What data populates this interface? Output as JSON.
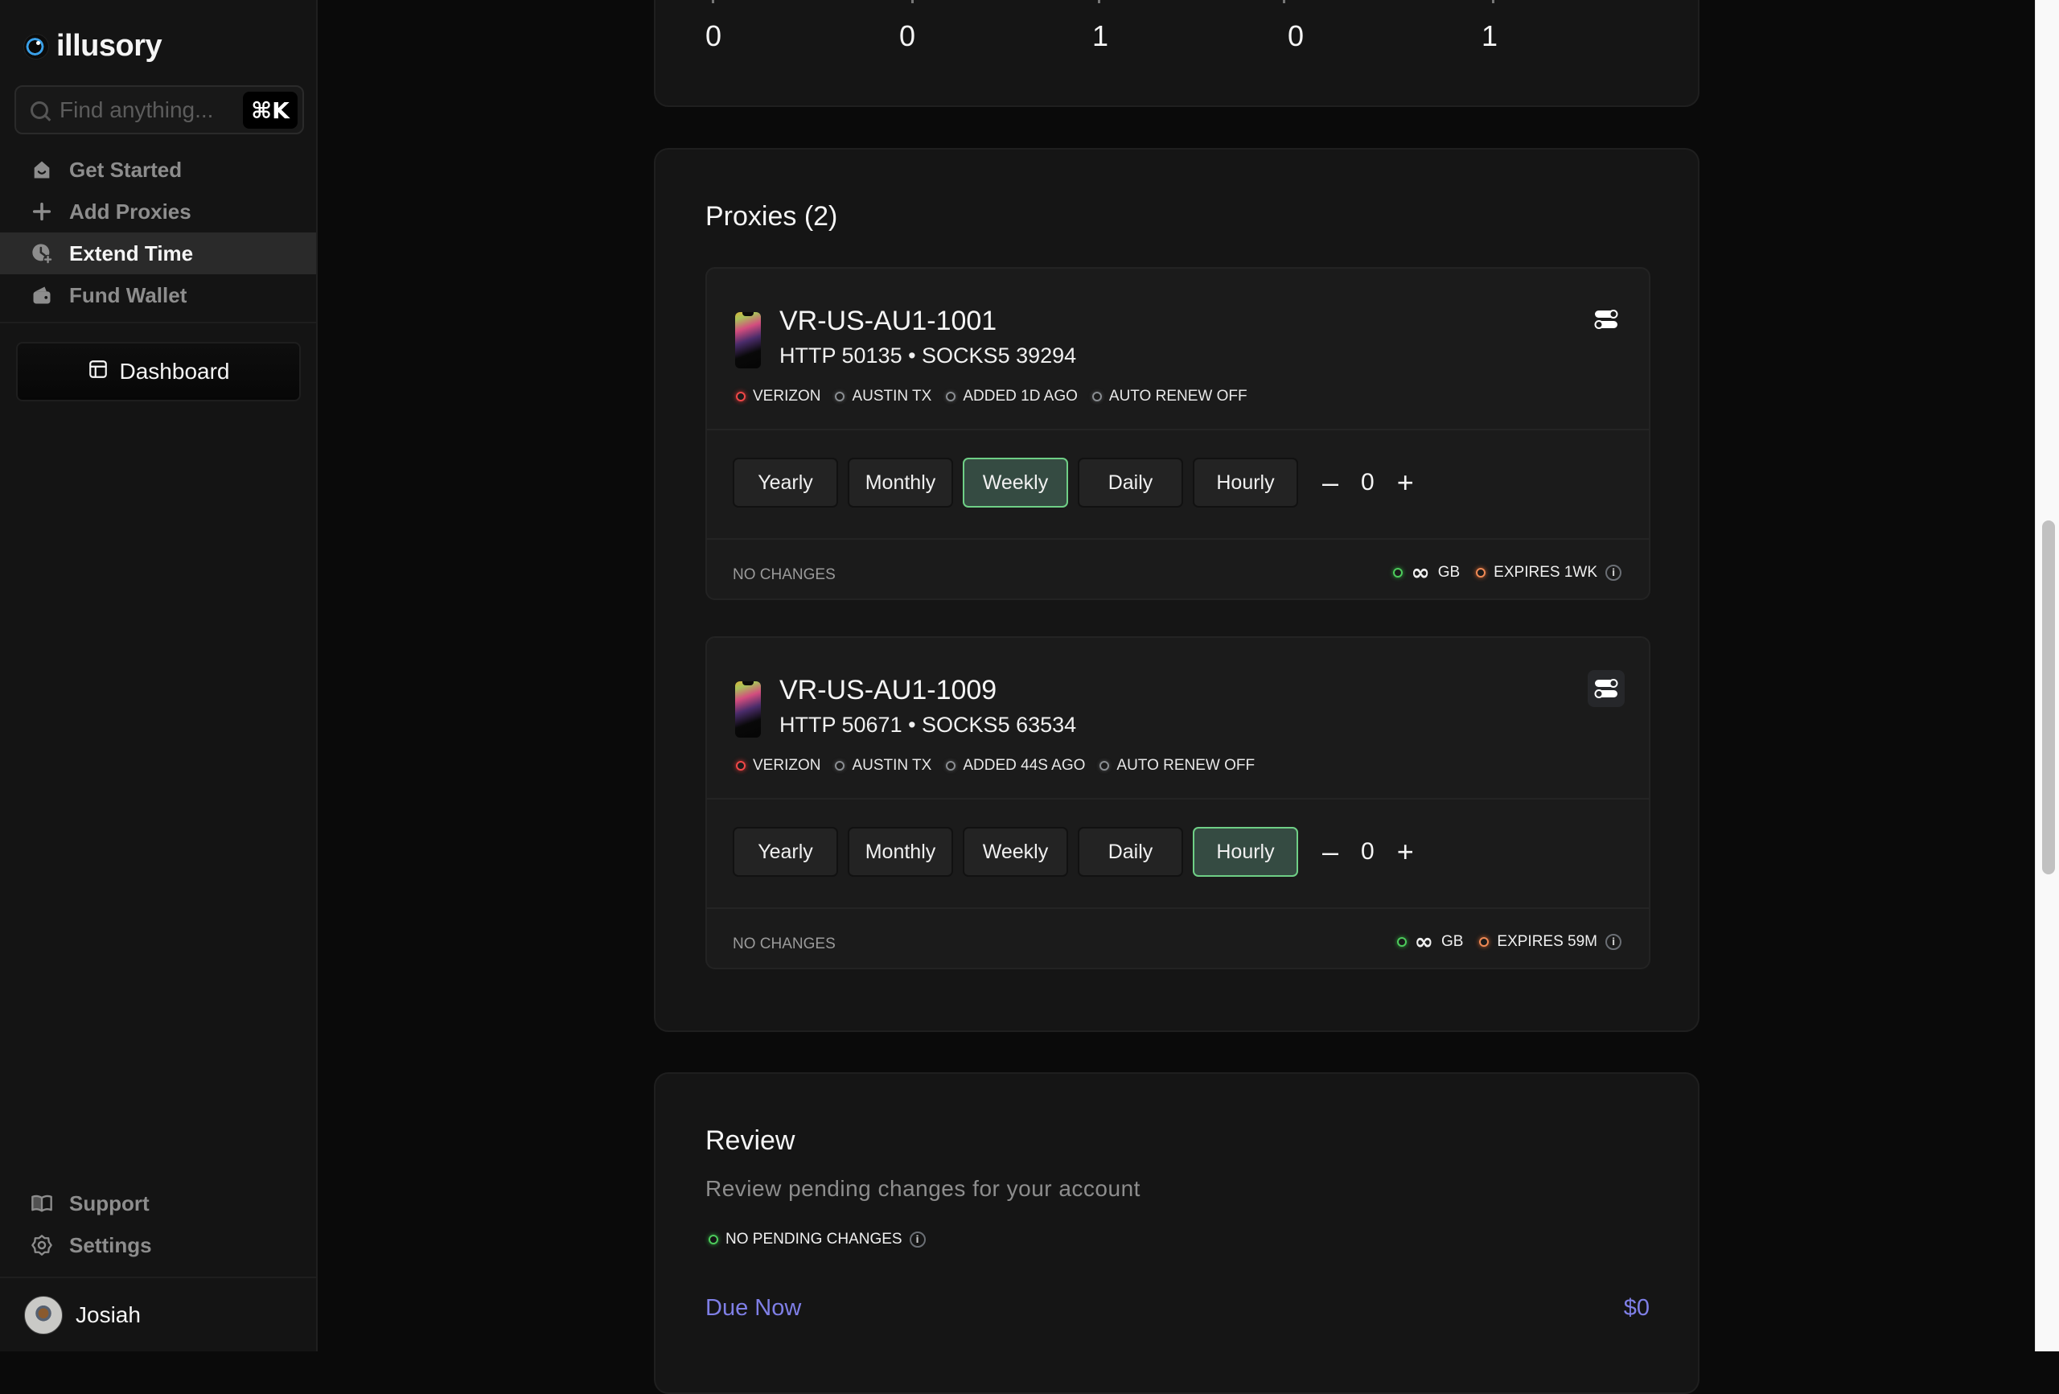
{
  "app": {
    "name": "illusory"
  },
  "sidebar": {
    "search": {
      "placeholder": "Find anything...",
      "value": "",
      "shortcut": "⌘K"
    },
    "nav": [
      {
        "label": "Get Started",
        "icon": "home-smile-icon",
        "active": false
      },
      {
        "label": "Add Proxies",
        "icon": "plus-icon",
        "active": false
      },
      {
        "label": "Extend Time",
        "icon": "clock-plus-icon",
        "active": true
      },
      {
        "label": "Fund Wallet",
        "icon": "wallet-icon",
        "active": false
      }
    ],
    "dashboard_button": {
      "label": "Dashboard",
      "icon": "layout-icon"
    },
    "bottom_nav": [
      {
        "label": "Support",
        "icon": "book-open-icon"
      },
      {
        "label": "Settings",
        "icon": "gear-icon"
      }
    ],
    "user": {
      "name": "Josiah"
    }
  },
  "stats": {
    "values": [
      "0",
      "0",
      "1",
      "0",
      "1"
    ]
  },
  "proxies": {
    "title": "Proxies (2)",
    "items": [
      {
        "name": "VR-US-AU1-1001",
        "ports": "HTTP 50135 • SOCKS5 39294",
        "tags": [
          {
            "label": "VERIZON",
            "status": "red"
          },
          {
            "label": "AUSTIN TX",
            "status": "grey"
          },
          {
            "label": "ADDED 1D AGO",
            "status": "grey"
          },
          {
            "label": "AUTO RENEW OFF",
            "status": "grey"
          }
        ],
        "periods": [
          "Yearly",
          "Monthly",
          "Weekly",
          "Daily",
          "Hourly"
        ],
        "selected_period": "Weekly",
        "quantity": "0",
        "decrement": "–",
        "increment": "+",
        "change_status": "NO CHANGES",
        "data_allowance": "GB",
        "data_allowance_symbol": "∞",
        "expires": "EXPIRES 1WK"
      },
      {
        "name": "VR-US-AU1-1009",
        "ports": "HTTP 50671 • SOCKS5 63534",
        "tags": [
          {
            "label": "VERIZON",
            "status": "red"
          },
          {
            "label": "AUSTIN TX",
            "status": "grey"
          },
          {
            "label": "ADDED 44S AGO",
            "status": "grey"
          },
          {
            "label": "AUTO RENEW OFF",
            "status": "grey"
          }
        ],
        "periods": [
          "Yearly",
          "Monthly",
          "Weekly",
          "Daily",
          "Hourly"
        ],
        "selected_period": "Hourly",
        "quantity": "0",
        "decrement": "–",
        "increment": "+",
        "change_status": "NO CHANGES",
        "data_allowance": "GB",
        "data_allowance_symbol": "∞",
        "expires": "EXPIRES 59M"
      }
    ]
  },
  "review": {
    "title": "Review",
    "subtitle": "Review pending changes for your account",
    "status": "NO PENDING CHANGES",
    "due_label": "Due Now",
    "due_value": "$0"
  },
  "colors": {
    "accent_selected_bg": "#354b42",
    "accent_selected_border": "#6fcf86",
    "due_text": "#7f7fe6",
    "status_red": "#f04848",
    "status_green": "#4dcc5c",
    "status_orange": "#f08a55"
  }
}
